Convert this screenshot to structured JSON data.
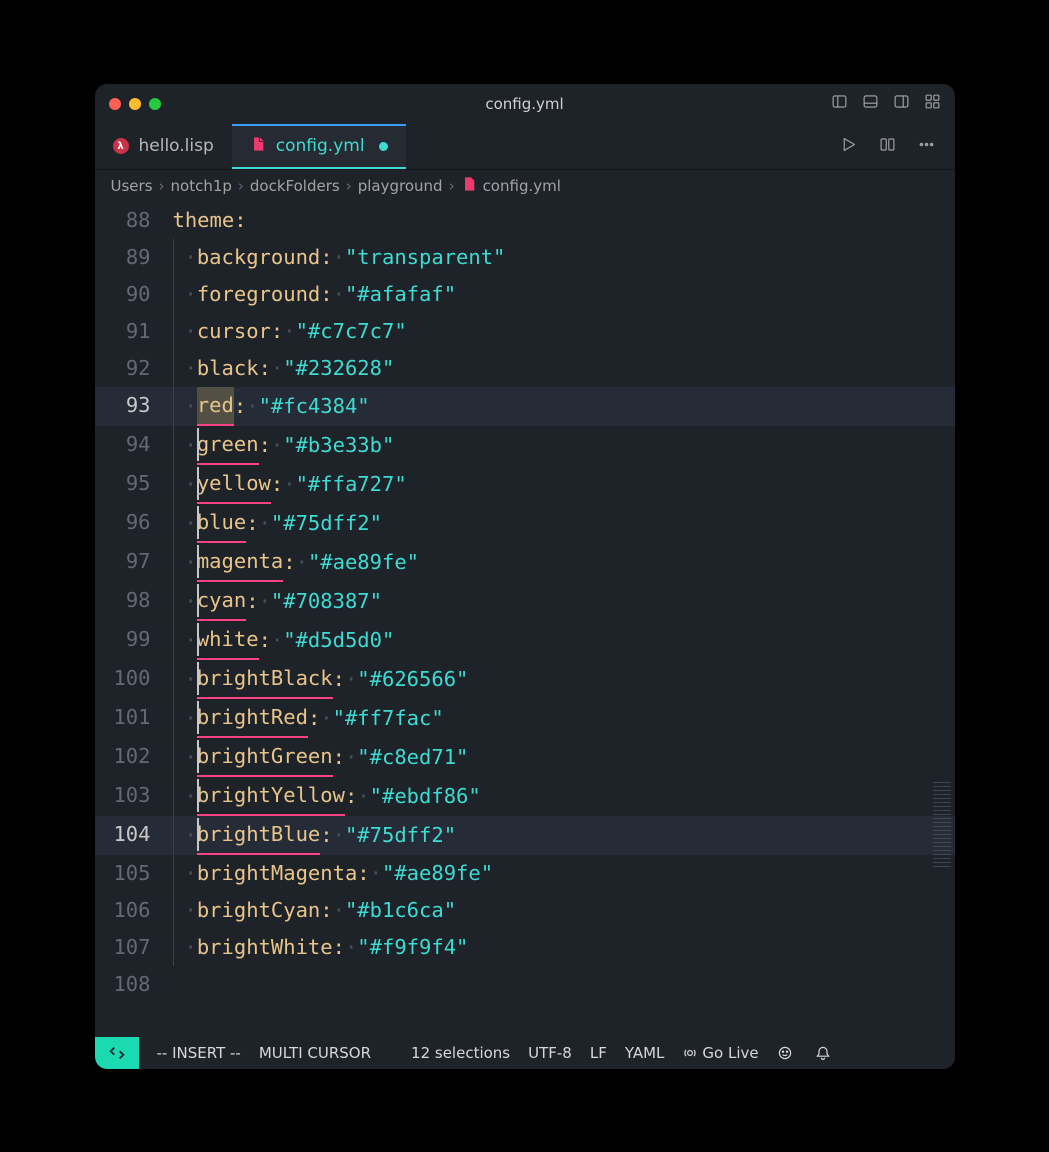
{
  "window": {
    "title": "config.yml"
  },
  "tabs": [
    {
      "label": "hello.lisp",
      "icon": "lisp",
      "active": false,
      "dirty": false
    },
    {
      "label": "config.yml",
      "icon": "yml",
      "active": true,
      "dirty": true
    }
  ],
  "breadcrumbs": {
    "parts": [
      "Users",
      "notch1p",
      "dockFolders",
      "playground"
    ],
    "file": "config.yml"
  },
  "lines": [
    {
      "num": "88",
      "indent": 0,
      "key": "theme",
      "value": null,
      "current": false,
      "cursor": false
    },
    {
      "num": "89",
      "indent": 1,
      "key": "background",
      "value": "\"transparent\"",
      "current": false,
      "cursor": false
    },
    {
      "num": "90",
      "indent": 1,
      "key": "foreground",
      "value": "\"#afafaf\"",
      "current": false,
      "cursor": false
    },
    {
      "num": "91",
      "indent": 1,
      "key": "cursor",
      "value": "\"#c7c7c7\"",
      "current": false,
      "cursor": false
    },
    {
      "num": "92",
      "indent": 1,
      "key": "black",
      "value": "\"#232628\"",
      "current": false,
      "cursor": false
    },
    {
      "num": "93",
      "indent": 1,
      "key": "red",
      "value": "\"#fc4384\"",
      "current": true,
      "cursor": false,
      "highlight_key": true
    },
    {
      "num": "94",
      "indent": 1,
      "key": "green",
      "value": "\"#b3e33b\"",
      "current": false,
      "cursor": true
    },
    {
      "num": "95",
      "indent": 1,
      "key": "yellow",
      "value": "\"#ffa727\"",
      "current": false,
      "cursor": true
    },
    {
      "num": "96",
      "indent": 1,
      "key": "blue",
      "value": "\"#75dff2\"",
      "current": false,
      "cursor": true
    },
    {
      "num": "97",
      "indent": 1,
      "key": "magenta",
      "value": "\"#ae89fe\"",
      "current": false,
      "cursor": true
    },
    {
      "num": "98",
      "indent": 1,
      "key": "cyan",
      "value": "\"#708387\"",
      "current": false,
      "cursor": true
    },
    {
      "num": "99",
      "indent": 1,
      "key": "white",
      "value": "\"#d5d5d0\"",
      "current": false,
      "cursor": true
    },
    {
      "num": "100",
      "indent": 1,
      "key": "brightBlack",
      "value": "\"#626566\"",
      "current": false,
      "cursor": true
    },
    {
      "num": "101",
      "indent": 1,
      "key": "brightRed",
      "value": "\"#ff7fac\"",
      "current": false,
      "cursor": true
    },
    {
      "num": "102",
      "indent": 1,
      "key": "brightGreen",
      "value": "\"#c8ed71\"",
      "current": false,
      "cursor": true
    },
    {
      "num": "103",
      "indent": 1,
      "key": "brightYellow",
      "value": "\"#ebdf86\"",
      "current": false,
      "cursor": true
    },
    {
      "num": "104",
      "indent": 1,
      "key": "brightBlue",
      "value": "\"#75dff2\"",
      "current": true,
      "cursor": true
    },
    {
      "num": "105",
      "indent": 1,
      "key": "brightMagenta",
      "value": "\"#ae89fe\"",
      "current": false,
      "cursor": false
    },
    {
      "num": "106",
      "indent": 1,
      "key": "brightCyan",
      "value": "\"#b1c6ca\"",
      "current": false,
      "cursor": false
    },
    {
      "num": "107",
      "indent": 1,
      "key": "brightWhite",
      "value": "\"#f9f9f4\"",
      "current": false,
      "cursor": false
    },
    {
      "num": "108",
      "indent": 0,
      "key": null,
      "value": null,
      "current": false,
      "cursor": false
    }
  ],
  "status": {
    "mode": "-- INSERT --",
    "multicursor": "MULTI CURSOR",
    "selections": "12 selections",
    "encoding": "UTF-8",
    "eol": "LF",
    "lang": "YAML",
    "golive": "Go Live"
  }
}
